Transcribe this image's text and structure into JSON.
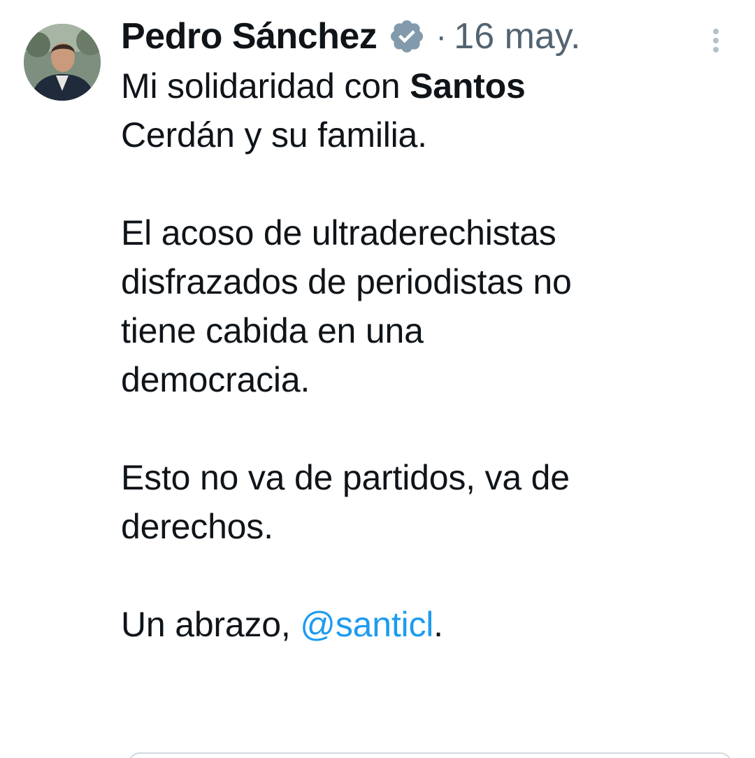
{
  "author": {
    "name": "Pedro Sánchez",
    "verified": true,
    "timestamp": "16 may.",
    "separator": "·"
  },
  "tweet": {
    "line1_prefix": "Mi solidaridad con ",
    "line1_bold": "Santos",
    "line2": "Cerdán y su familia.",
    "paragraph2": [
      "El acoso de ultraderechistas",
      "disfrazados de periodistas no",
      "tiene cabida en una",
      "democracia."
    ],
    "paragraph3": [
      "Esto no va de partidos, va de",
      "derechos."
    ],
    "closing_prefix": "Un abrazo, ",
    "mention": "@santicl",
    "closing_suffix": "."
  },
  "icons": {
    "verified": "verified-badge-icon",
    "more": "more-vertical-icon"
  },
  "colors": {
    "text": "#0f1419",
    "secondary": "#536471",
    "link": "#1d9bf0",
    "verified_badge": "#829aab"
  }
}
